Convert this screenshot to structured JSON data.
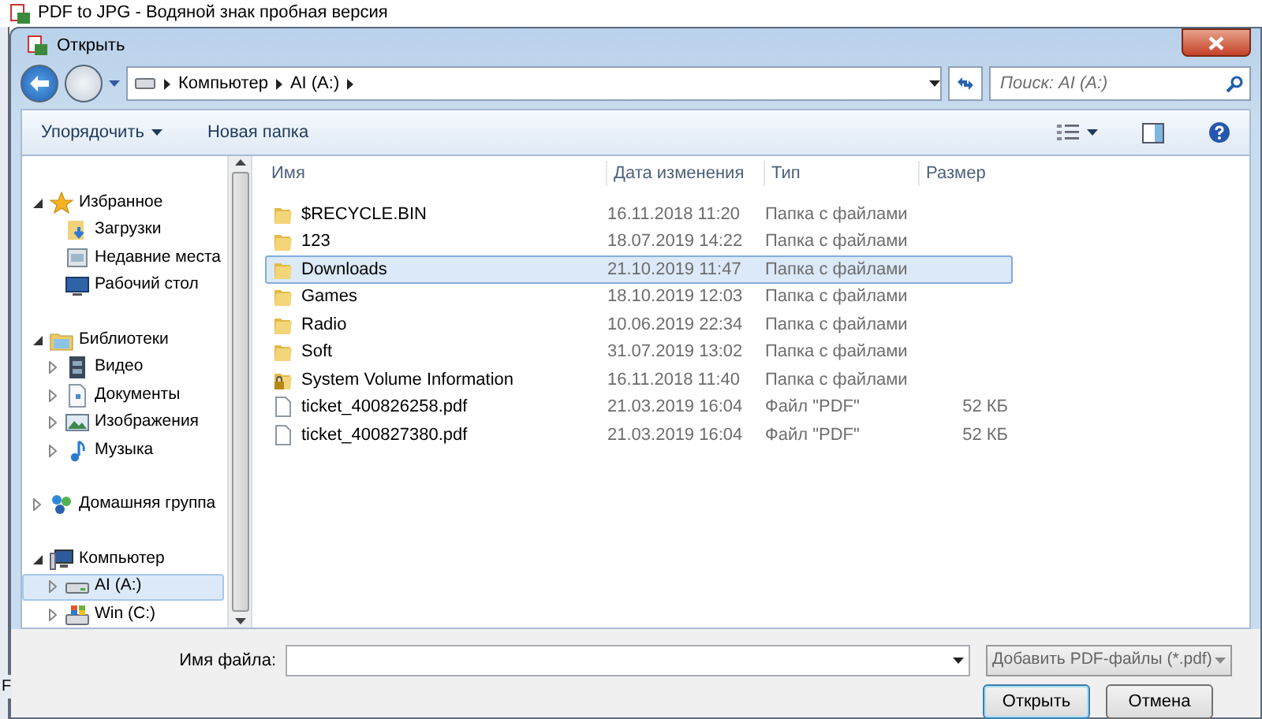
{
  "background_window": {
    "title": "PDF to JPG - Водяной знак пробная версия",
    "edge_text": "F"
  },
  "dialog": {
    "title": "Открыть"
  },
  "address_bar": {
    "crumbs": [
      "Компьютер",
      "AI (A:)"
    ],
    "search_placeholder": "Поиск: AI (A:)"
  },
  "toolbar": {
    "organize": "Упорядочить",
    "new_folder": "Новая папка"
  },
  "nav": [
    {
      "label": "Избранное",
      "kind": "star",
      "expanded": true,
      "selected": false,
      "children": [
        {
          "label": "Загрузки",
          "kind": "downloads",
          "selected": false
        },
        {
          "label": "Недавние места",
          "kind": "recent",
          "selected": false
        },
        {
          "label": "Рабочий стол",
          "kind": "desktop",
          "selected": false
        }
      ]
    },
    {
      "label": "Библиотеки",
      "kind": "library",
      "expanded": true,
      "selected": false,
      "children": [
        {
          "label": "Видео",
          "kind": "video",
          "expanded": false,
          "selected": false
        },
        {
          "label": "Документы",
          "kind": "document",
          "expanded": false,
          "selected": false
        },
        {
          "label": "Изображения",
          "kind": "image",
          "expanded": false,
          "selected": false
        },
        {
          "label": "Музыка",
          "kind": "music",
          "expanded": false,
          "selected": false
        }
      ]
    },
    {
      "label": "Домашняя группа",
      "kind": "homegroup",
      "expanded": false,
      "selected": false
    },
    {
      "label": "Компьютер",
      "kind": "computer",
      "expanded": true,
      "selected": false,
      "children": [
        {
          "label": "AI (A:)",
          "kind": "drive",
          "expanded": false,
          "selected": true
        },
        {
          "label": "Win (C:)",
          "kind": "windrive",
          "expanded": false,
          "selected": false
        }
      ]
    }
  ],
  "columns": [
    "Имя",
    "Дата изменения",
    "Тип",
    "Размер"
  ],
  "files": [
    {
      "kind": "folder",
      "name": "$RECYCLE.BIN",
      "date": "16.11.2018 11:20",
      "type": "Папка с файлами",
      "selected": false
    },
    {
      "kind": "folder",
      "name": "123",
      "date": "18.07.2019 14:22",
      "type": "Папка с файлами",
      "selected": false
    },
    {
      "kind": "folder",
      "name": "Downloads",
      "date": "21.10.2019 11:47",
      "type": "Папка с файлами",
      "selected": true
    },
    {
      "kind": "folder",
      "name": "Games",
      "date": "18.10.2019 12:03",
      "type": "Папка с файлами",
      "selected": false
    },
    {
      "kind": "folder",
      "name": "Radio",
      "date": "10.06.2019 22:34",
      "type": "Папка с файлами",
      "selected": false
    },
    {
      "kind": "folder",
      "name": "Soft",
      "date": "31.07.2019 13:02",
      "type": "Папка с файлами",
      "selected": false
    },
    {
      "kind": "locked",
      "name": "System Volume Information",
      "date": "16.11.2018 11:40",
      "type": "Папка с файлами",
      "selected": false
    },
    {
      "kind": "file",
      "name": "ticket_400826258.pdf",
      "date": "21.03.2019 16:04",
      "type": "Файл \"PDF\"",
      "size": "52 КБ",
      "selected": false
    },
    {
      "kind": "file",
      "name": "ticket_400827380.pdf",
      "date": "21.03.2019 16:04",
      "type": "Файл \"PDF\"",
      "size": "52 КБ",
      "selected": false
    }
  ],
  "footer": {
    "filename_label": "Имя файла:",
    "filetype": "Добавить PDF-файлы (*.pdf)",
    "buttons": [
      "Открыть",
      "Отмена"
    ]
  }
}
